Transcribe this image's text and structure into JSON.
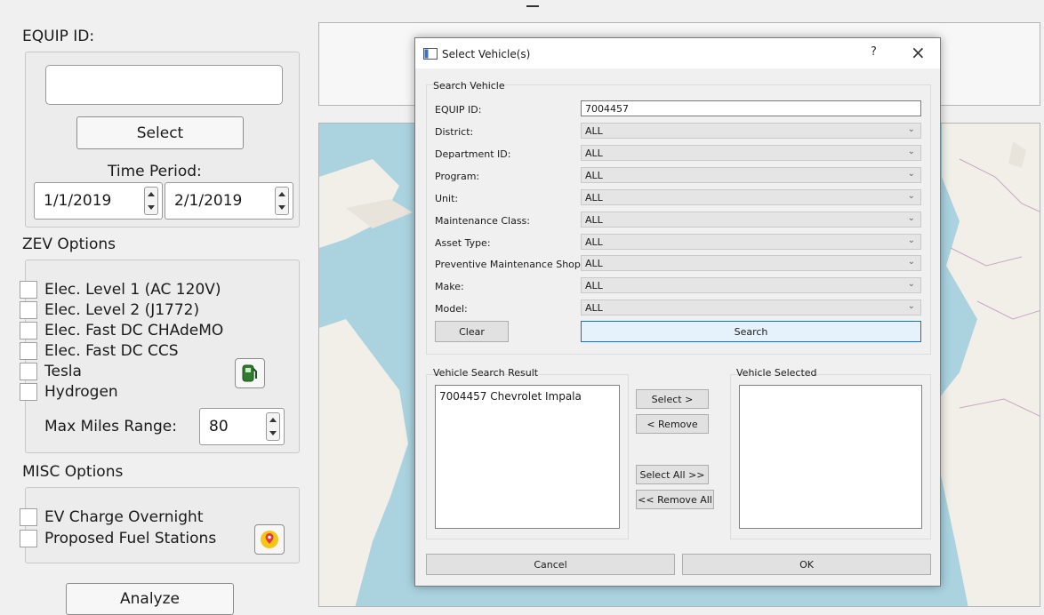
{
  "left_panel": {
    "equip_id_label": "EQUIP ID:",
    "equip_id_value": "",
    "select_button": "Select",
    "time_period_label": "Time Period:",
    "start_date": "1/1/2019",
    "end_date": "2/1/2019",
    "zev_options_label": "ZEV Options",
    "zev_options": [
      {
        "label": "Elec. Level 1 (AC 120V)",
        "checked": false
      },
      {
        "label": "Elec. Level 2 (J1772)",
        "checked": false
      },
      {
        "label": "Elec. Fast DC CHAdeMO",
        "checked": false
      },
      {
        "label": "Elec. Fast DC CCS",
        "checked": false
      },
      {
        "label": "Tesla",
        "checked": false
      },
      {
        "label": "Hydrogen",
        "checked": false
      }
    ],
    "max_miles_label": "Max Miles Range:",
    "max_miles_value": "80",
    "misc_options_label": "MISC Options",
    "misc_options": [
      {
        "label": "EV Charge Overnight",
        "checked": false
      },
      {
        "label": "Proposed Fuel Stations",
        "checked": false
      }
    ],
    "analyze_button": "Analyze",
    "fuel_icon": "fuel-pump-icon",
    "map_icon": "map-marker-icon"
  },
  "dialog": {
    "title": "Select Vehicle(s)",
    "help_button": "?",
    "close_button": "×",
    "search_group_label": "Search Vehicle",
    "fields": {
      "equip_id": {
        "label": "EQUIP ID:",
        "value": "7004457"
      },
      "district": {
        "label": "District:",
        "value": "ALL"
      },
      "department_id": {
        "label": "Department ID:",
        "value": "ALL"
      },
      "program": {
        "label": "Program:",
        "value": "ALL"
      },
      "unit": {
        "label": "Unit:",
        "value": "ALL"
      },
      "maintenance_class": {
        "label": "Maintenance Class:",
        "value": "ALL"
      },
      "asset_type": {
        "label": "Asset Type:",
        "value": "ALL"
      },
      "pm_shop": {
        "label": "Preventive Maintenance Shop:",
        "value": "ALL"
      },
      "make": {
        "label": "Make:",
        "value": "ALL"
      },
      "model": {
        "label": "Model:",
        "value": "ALL"
      }
    },
    "clear_button": "Clear",
    "search_button": "Search",
    "result_group_label": "Vehicle Search Result",
    "search_results": [
      "7004457 Chevrolet Impala"
    ],
    "selected_group_label": "Vehicle Selected",
    "selected_vehicles": [],
    "select_button": "Select >",
    "remove_button": "< Remove",
    "select_all_button": "Select All >>",
    "remove_all_button": "<< Remove All",
    "cancel_button": "Cancel",
    "ok_button": "OK"
  },
  "colors": {
    "window_bg": "#f0f0f0",
    "map_water": "#aad3df",
    "map_land": "#f2efe9",
    "search_button_border": "#0078d7"
  }
}
